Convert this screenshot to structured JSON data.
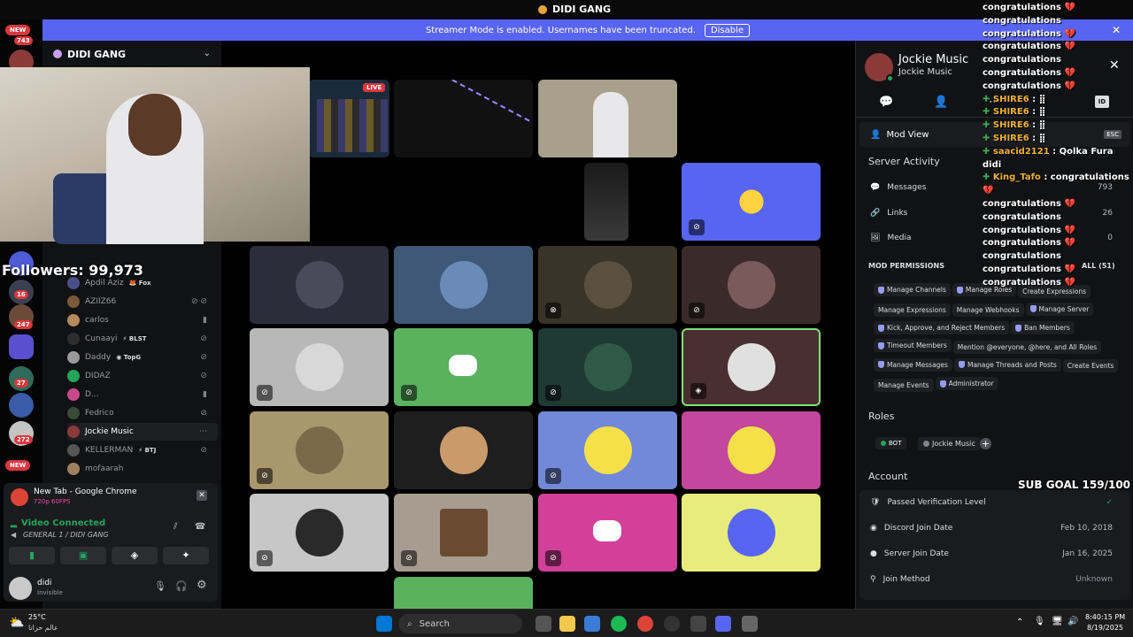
{
  "title_bar": {
    "title": "DIDI GANG"
  },
  "banner": {
    "text": "Streamer Mode is enabled. Usernames have been truncated.",
    "button": "Disable"
  },
  "rail": {
    "badges": [
      "743",
      "16",
      "247",
      "27",
      "272"
    ],
    "new_label": "NEW"
  },
  "server": {
    "name": "DIDI GANG"
  },
  "stream_overlay": {
    "followers": "Followers: 99,973",
    "sub_goal": "SUB GOAL 159/100"
  },
  "members": [
    {
      "name": "Apdil Aziz",
      "tag": "Fox"
    },
    {
      "name": "AZIIZ66",
      "tag": ""
    },
    {
      "name": "carlos",
      "tag": ""
    },
    {
      "name": "Cunaayi",
      "tag": "BLST"
    },
    {
      "name": "Daddy",
      "tag": "TopG"
    },
    {
      "name": "DIDAZ",
      "tag": ""
    },
    {
      "name": "D...",
      "tag": ""
    },
    {
      "name": "Fedrico",
      "tag": ""
    },
    {
      "name": "Jockie Music",
      "tag": ""
    },
    {
      "name": "KELLERMAN",
      "tag": "BTJ"
    },
    {
      "name": "mofaarah",
      "tag": ""
    }
  ],
  "activity": {
    "title": "New Tab - Google Chrome",
    "subtitle": "720p 60FPS"
  },
  "voice": {
    "status": "Video Connected",
    "channel": "GENERAL 1 / DIDI GANG"
  },
  "user": {
    "name": "didi",
    "status": "Invisible"
  },
  "grid": {
    "live_badge": "LIVE"
  },
  "profile": {
    "display_name": "Jockie Music",
    "username": "Jockie Music",
    "esc": "ESC",
    "mod_view": "Mod View",
    "server_activity": "Server Activity",
    "activity_rows": [
      {
        "label": "Messages",
        "value": "793"
      },
      {
        "label": "Links",
        "value": "26"
      },
      {
        "label": "Media",
        "value": "0"
      }
    ],
    "mod_permissions_title": "MOD PERMISSIONS",
    "mod_permissions_all": "ALL (51)",
    "permissions": [
      {
        "label": "Manage Channels",
        "shield": true
      },
      {
        "label": "Manage Roles",
        "shield": true
      },
      {
        "label": "Create Expressions",
        "shield": false
      },
      {
        "label": "Manage Expressions",
        "shield": false
      },
      {
        "label": "Manage Webhooks",
        "shield": false
      },
      {
        "label": "Manage Server",
        "shield": true
      },
      {
        "label": "Kick, Approve, and Reject Members",
        "shield": true
      },
      {
        "label": "Ban Members",
        "shield": true
      },
      {
        "label": "Timeout Members",
        "shield": true
      },
      {
        "label": "Mention @everyone, @here, and All Roles",
        "shield": false
      },
      {
        "label": "Manage Messages",
        "shield": true
      },
      {
        "label": "Manage Threads and Posts",
        "shield": true
      },
      {
        "label": "Create Events",
        "shield": false
      },
      {
        "label": "Manage Events",
        "shield": false
      },
      {
        "label": "Administrator",
        "shield": true
      }
    ],
    "roles_title": "Roles",
    "roles": [
      "BOT",
      "Jockie Music"
    ],
    "account_title": "Account",
    "account_rows": [
      {
        "label": "Passed Verification Level",
        "value": "✓"
      },
      {
        "label": "Discord Join Date",
        "value": "Feb 10, 2018"
      },
      {
        "label": "Server Join Date",
        "value": "Jan 16, 2025"
      },
      {
        "label": "Join Method",
        "value": "Unknown"
      }
    ]
  },
  "chat_overlay": [
    {
      "user": "",
      "text": "congratulations 💔 congratulations"
    },
    {
      "user": "",
      "text": "congratulations 💔"
    },
    {
      "user": "",
      "text": "congratulations 💔 congratulations"
    },
    {
      "user": "",
      "text": "congratulations 💔"
    },
    {
      "user": "",
      "text": "congratulations 💔"
    },
    {
      "user": "SHIRE6",
      "text": " : ⣿"
    },
    {
      "user": "SHIRE6",
      "text": " : ⣿"
    },
    {
      "user": "SHIRE6",
      "text": " : ⣿"
    },
    {
      "user": "SHIRE6",
      "text": " : ⣿"
    },
    {
      "user": "saacid2121",
      "text": " : Qolka Fura didi"
    },
    {
      "user": "King_Tafo",
      "text": " : congratulations 💔"
    },
    {
      "user": "",
      "text": "congratulations 💔 congratulations"
    },
    {
      "user": "",
      "text": "congratulations 💔"
    },
    {
      "user": "",
      "text": "congratulations 💔 congratulations"
    },
    {
      "user": "",
      "text": "congratulations 💔"
    },
    {
      "user": "",
      "text": "congratulations 💔"
    }
  ],
  "taskbar": {
    "weather_temp": "25°C",
    "weather_desc": "عالم حزانا",
    "search": "Search",
    "time": "8:40:15 PM",
    "date": "8/19/2025"
  },
  "colors": {
    "blurple": "#5865f2",
    "sidebar": "#111214",
    "green": "#23a55a",
    "red": "#da373c"
  }
}
